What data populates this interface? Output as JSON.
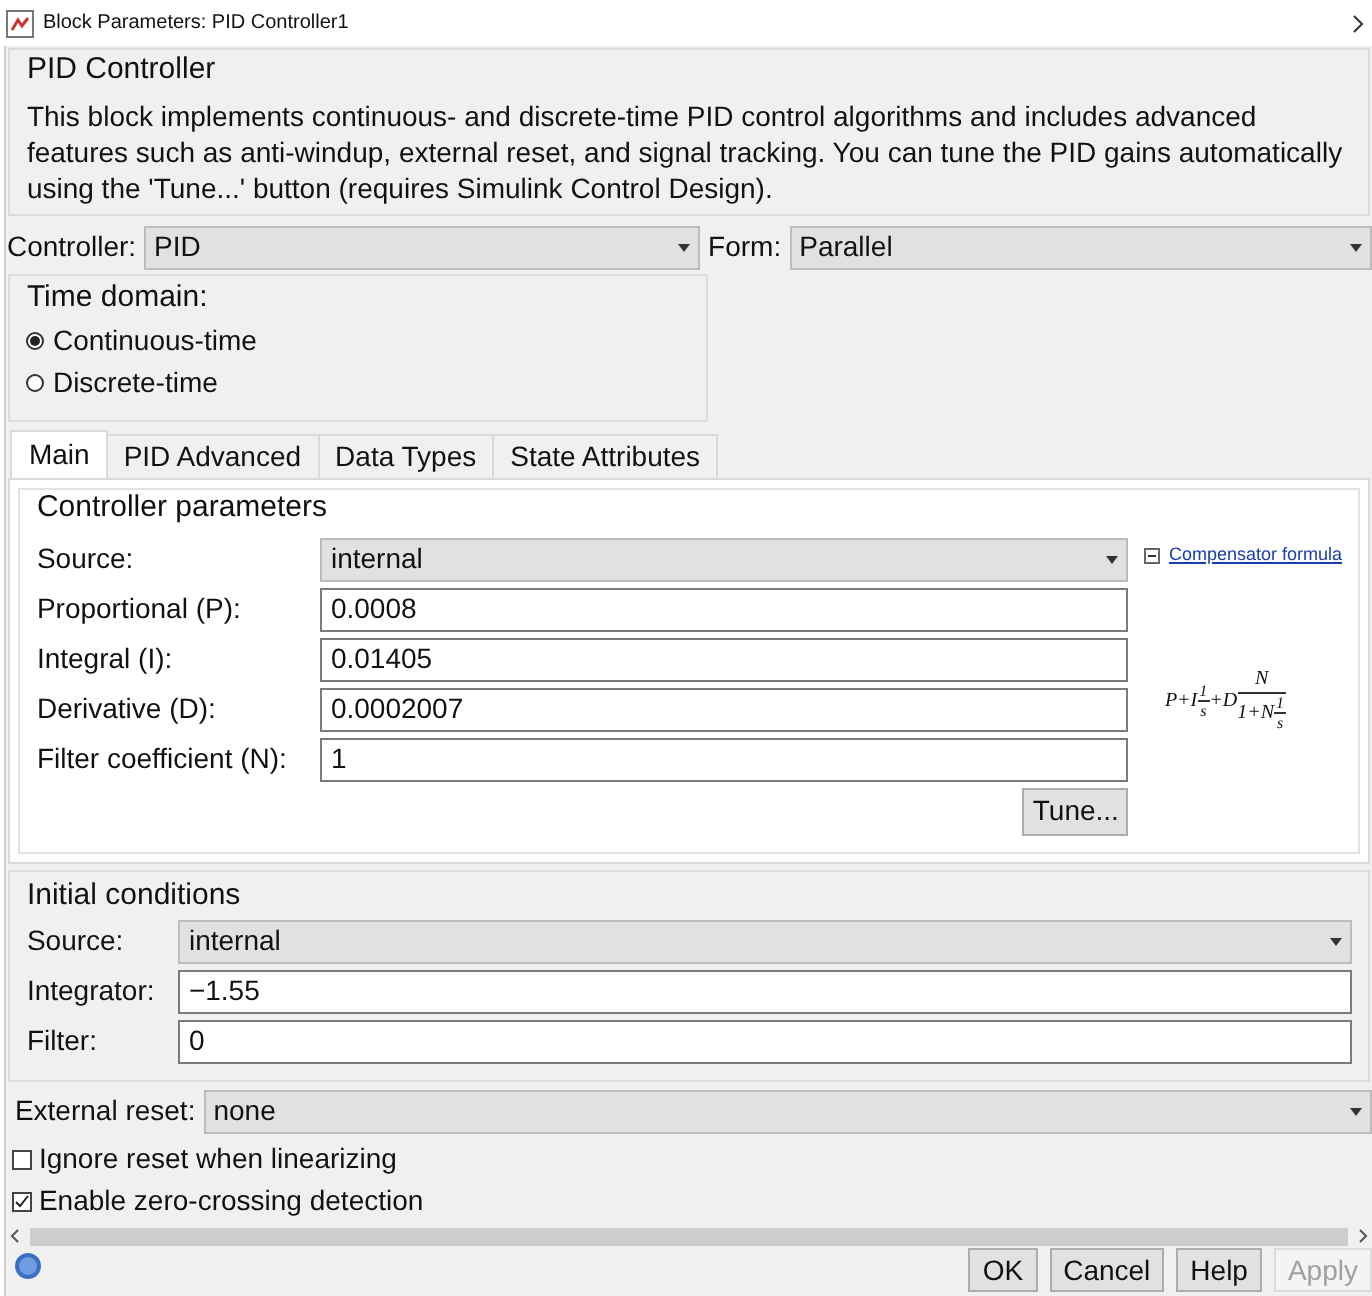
{
  "window": {
    "title": "Block Parameters: PID Controller1"
  },
  "block": {
    "name": "PID Controller",
    "description": "This block implements continuous- and discrete-time PID control algorithms and includes advanced features such as anti-windup, external reset, and signal tracking. You can tune the PID gains automatically using the 'Tune...' button (requires Simulink Control Design)."
  },
  "controller": {
    "label": "Controller:",
    "value": "PID"
  },
  "form": {
    "label": "Form:",
    "value": "Parallel"
  },
  "time_domain": {
    "title": "Time domain:",
    "options": [
      {
        "label": "Continuous-time",
        "selected": true
      },
      {
        "label": "Discrete-time",
        "selected": false
      }
    ]
  },
  "tabs": [
    {
      "label": "Main",
      "selected": true
    },
    {
      "label": "PID Advanced",
      "selected": false
    },
    {
      "label": "Data Types",
      "selected": false
    },
    {
      "label": "State Attributes",
      "selected": false
    }
  ],
  "controller_parameters": {
    "title": "Controller parameters",
    "fields": [
      {
        "kind": "dropdown",
        "label": "Source:",
        "value": "internal"
      },
      {
        "kind": "text",
        "label": "Proportional (P):",
        "value": "0.0008"
      },
      {
        "kind": "text",
        "label": "Integral (I):",
        "value": "0.01405"
      },
      {
        "kind": "text",
        "label": "Derivative (D):",
        "value": "0.0002007"
      },
      {
        "kind": "text",
        "label": "Filter coefficient (N):",
        "value": "1"
      }
    ],
    "tune_button": "Tune...",
    "formula_link": "Compensator formula",
    "formula": {
      "lead": "P+I",
      "frac1_num": "1",
      "frac1_den": "s",
      "mid": "+D",
      "frac2_num": "N",
      "frac2_den_lead": "1+N",
      "frac3_num": "1",
      "frac3_den": "s"
    }
  },
  "initial_conditions": {
    "title": "Initial conditions",
    "fields": [
      {
        "kind": "dropdown",
        "label": "Source:",
        "value": "internal"
      },
      {
        "kind": "text",
        "label": "Integrator:",
        "value": "−1.55"
      },
      {
        "kind": "text",
        "label": "Filter:",
        "value": "0"
      }
    ]
  },
  "external_reset": {
    "label": "External reset:",
    "value": "none"
  },
  "checkboxes": [
    {
      "label": "Ignore reset when linearizing",
      "checked": false
    },
    {
      "label": "Enable zero-crossing detection",
      "checked": true
    }
  ],
  "buttons": [
    {
      "label": "OK",
      "disabled": false
    },
    {
      "label": "Cancel",
      "disabled": false
    },
    {
      "label": "Help",
      "disabled": false
    },
    {
      "label": "Apply",
      "disabled": true
    }
  ]
}
